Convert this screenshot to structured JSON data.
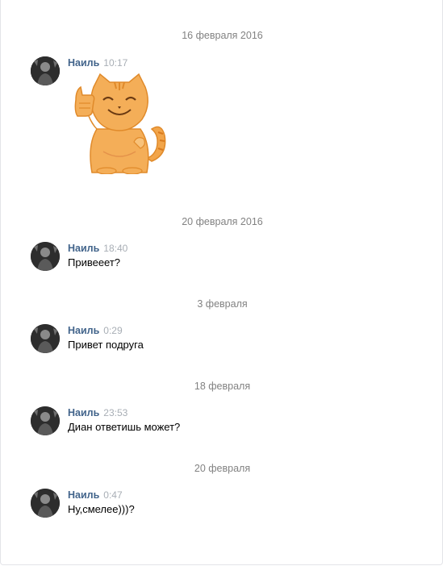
{
  "conversation": [
    {
      "date": "16 февраля 2016",
      "author": "Наиль",
      "time": "10:17",
      "text": "",
      "sticker": "thumbs-up-cat-sticker"
    },
    {
      "date": "20 февраля 2016",
      "author": "Наиль",
      "time": "18:40",
      "text": "Привееет?"
    },
    {
      "date": "3 февраля",
      "author": "Наиль",
      "time": "0:29",
      "text": "Привет подруга"
    },
    {
      "date": "18 февраля",
      "author": "Наиль",
      "time": "23:53",
      "text": "Диан ответишь может?"
    },
    {
      "date": "20 февраля",
      "author": "Наиль",
      "time": "0:47",
      "text": "Ну,смелее)))?"
    }
  ],
  "colors": {
    "author": "#42648b",
    "time": "#a8aeb5",
    "date_separator": "#828282",
    "sticker_cat": "#f2a54a"
  }
}
